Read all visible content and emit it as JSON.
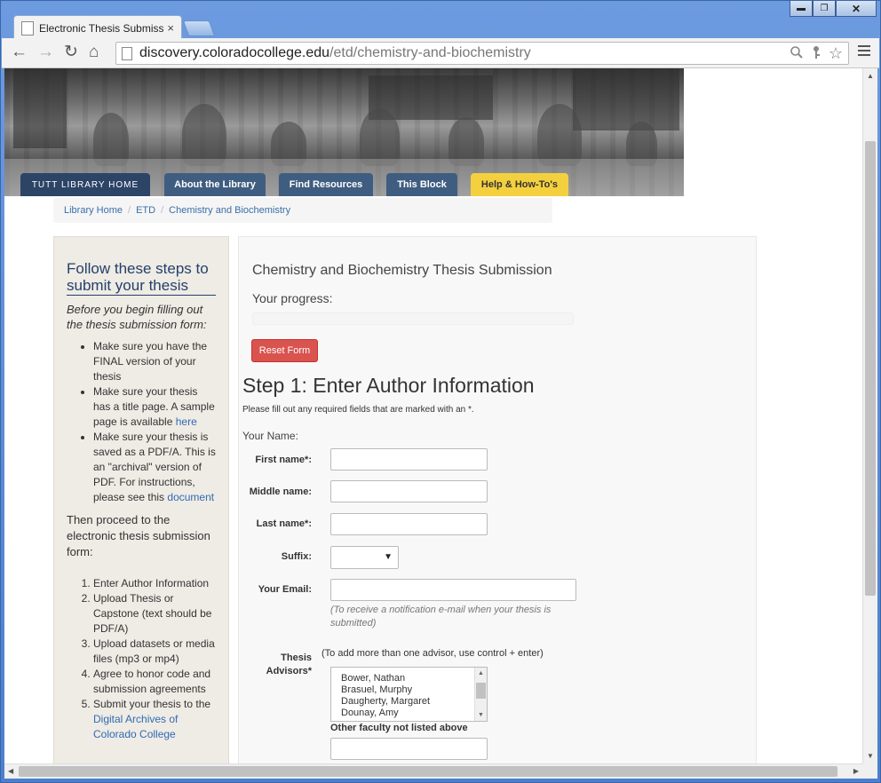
{
  "browser": {
    "tab_title": "Electronic Thesis Submissi",
    "tab_close": "×",
    "url_host": "discovery.coloradocollege.edu",
    "url_path": "/etd/chemistry-and-biochemistry",
    "back": "←",
    "forward": "→",
    "reload": "↻",
    "home": "⌂",
    "star": "☆",
    "minimize": "▬",
    "maximize": "❐",
    "close": "✕"
  },
  "nav": {
    "items": [
      {
        "label": "TUTT LIBRARY HOME"
      },
      {
        "label": "About the Library"
      },
      {
        "label": "Find Resources"
      },
      {
        "label": "This Block"
      },
      {
        "label": "Help & How-To's"
      }
    ]
  },
  "breadcrumb": {
    "items": [
      "Library Home",
      "ETD",
      "Chemistry and Biochemistry"
    ],
    "separator": "/"
  },
  "sidebar": {
    "heading": "Follow these steps to submit your thesis",
    "intro": "Before you begin filling out the thesis submission form:",
    "checklist": [
      {
        "text": "Make sure you have the FINAL version of your thesis",
        "link": ""
      },
      {
        "text": "Make sure your thesis has a title page. A sample page is available ",
        "link": "here"
      },
      {
        "text": "Make sure your thesis is saved as a PDF/A. This is an \"archival\" version of PDF. For instructions, please see this ",
        "link": "document"
      }
    ],
    "proceed": "Then proceed to the electronic thesis submission form:",
    "steps": [
      {
        "text": "Enter Author Information",
        "link": ""
      },
      {
        "text": "Upload Thesis or Capstone (text should be PDF/A)",
        "link": ""
      },
      {
        "text": "Upload datasets or media files (mp3 or mp4)",
        "link": ""
      },
      {
        "text": "Agree to honor code and submission agreements",
        "link": ""
      },
      {
        "text": "Submit your thesis to the ",
        "link": "Digital Archives of Colorado College"
      }
    ]
  },
  "form": {
    "title": "Chemistry and Biochemistry Thesis Submission",
    "progress_label": "Your progress:",
    "progress_value": 0,
    "reset_label": "Reset Form",
    "step_title": "Step 1: Enter Author Information",
    "step_note": "Please fill out any required fields that are marked with an *.",
    "your_name": "Your Name:",
    "first_name_label": "First name*:",
    "middle_name_label": "Middle name:",
    "last_name_label": "Last name*:",
    "suffix_label": "Suffix:",
    "suffix_value": "",
    "email_label": "Your Email:",
    "email_help": "(To receive a notification e-mail when your thesis is submitted)",
    "advisors_label": "Thesis Advisors*",
    "advisors_hint": "(To add more than one advisor, use control + enter)",
    "advisors": [
      "Bower, Nathan",
      "Brasuel, Murphy",
      "Daugherty, Margaret",
      "Dounay, Amy"
    ],
    "other_label": "Other faculty not listed above"
  }
}
